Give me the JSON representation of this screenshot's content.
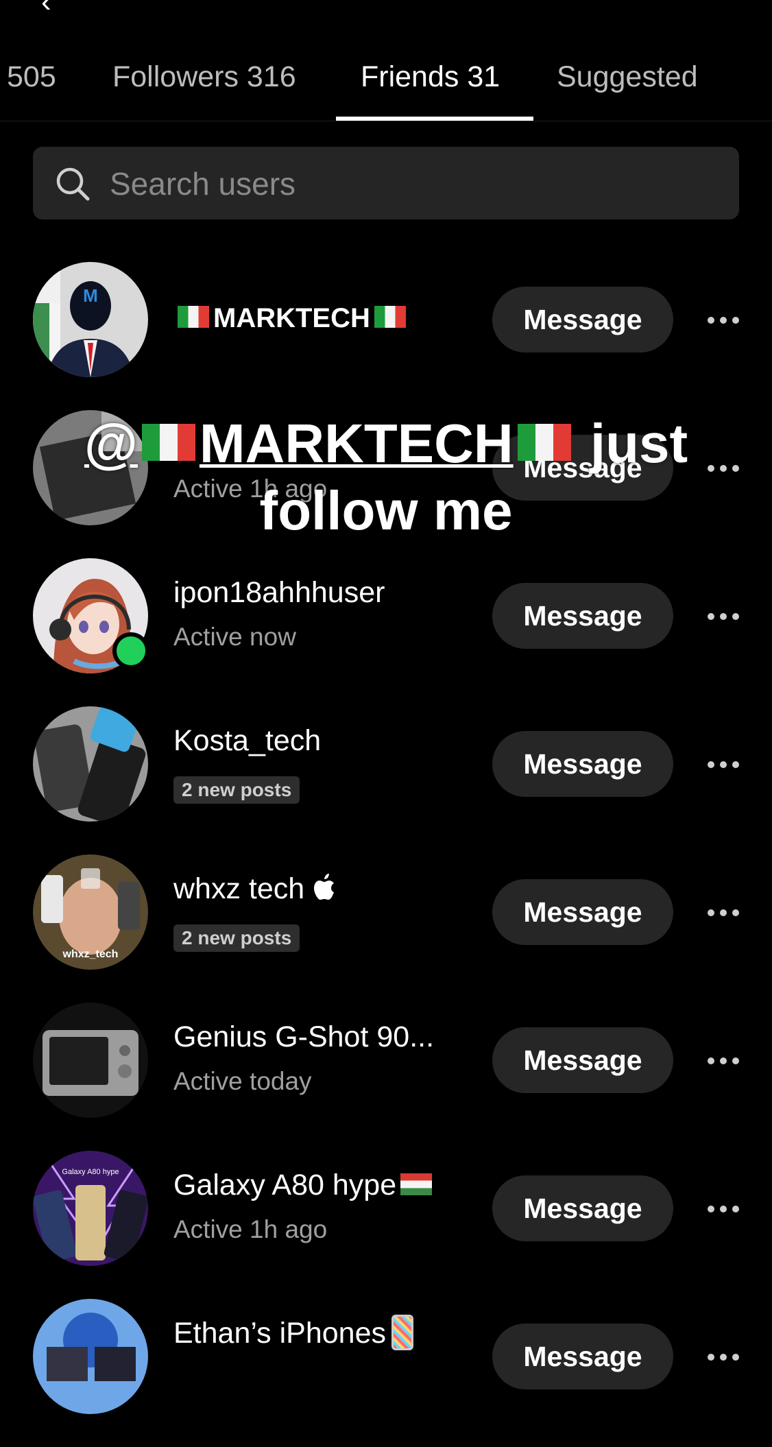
{
  "tabs": [
    {
      "label": "505"
    },
    {
      "label": "Followers 316"
    },
    {
      "label": "Friends 31"
    },
    {
      "label": "Suggested"
    }
  ],
  "active_tab": "Friends 31",
  "search": {
    "placeholder": "Search users"
  },
  "users": [
    {
      "name": "MARKTECH",
      "status": "",
      "badge": "",
      "online": false,
      "flag": "italy",
      "button": "Message"
    },
    {
      "name": "",
      "status": "Active 1h ago",
      "badge": "",
      "online": false,
      "button": "Message"
    },
    {
      "name": "ipon18ahhhuser",
      "status": "Active now",
      "badge": "",
      "online": true,
      "button": "Message"
    },
    {
      "name": "Kosta_tech",
      "status": "",
      "badge": "2 new posts",
      "online": false,
      "button": "Message"
    },
    {
      "name": "whxz tech ",
      "status": "",
      "badge": "2 new posts",
      "online": false,
      "button": "Message"
    },
    {
      "name": "Genius G-Shot 90...",
      "status": "Active today",
      "badge": "",
      "online": false,
      "button": "Message"
    },
    {
      "name": "Galaxy A80 hype",
      "status": "Active 1h ago",
      "badge": "",
      "online": false,
      "flag": "hungary",
      "button": "Message"
    },
    {
      "name": "Ethan’s iPhones",
      "status": "",
      "badge": "",
      "online": false,
      "button": "Message"
    }
  ],
  "overlay": {
    "mention": "@MARKTECH",
    "line1_suffix": "just",
    "line2": "follow me"
  },
  "avatar_art": {
    "whxz_tech_label": "whxz_tech",
    "galaxy_a80_label": "Galaxy A80 hype"
  },
  "colors": {
    "background": "#000000",
    "button_bg": "#262626",
    "search_bg": "#252525",
    "online_dot": "#20d05a",
    "muted_text": "#a0a0a0"
  }
}
